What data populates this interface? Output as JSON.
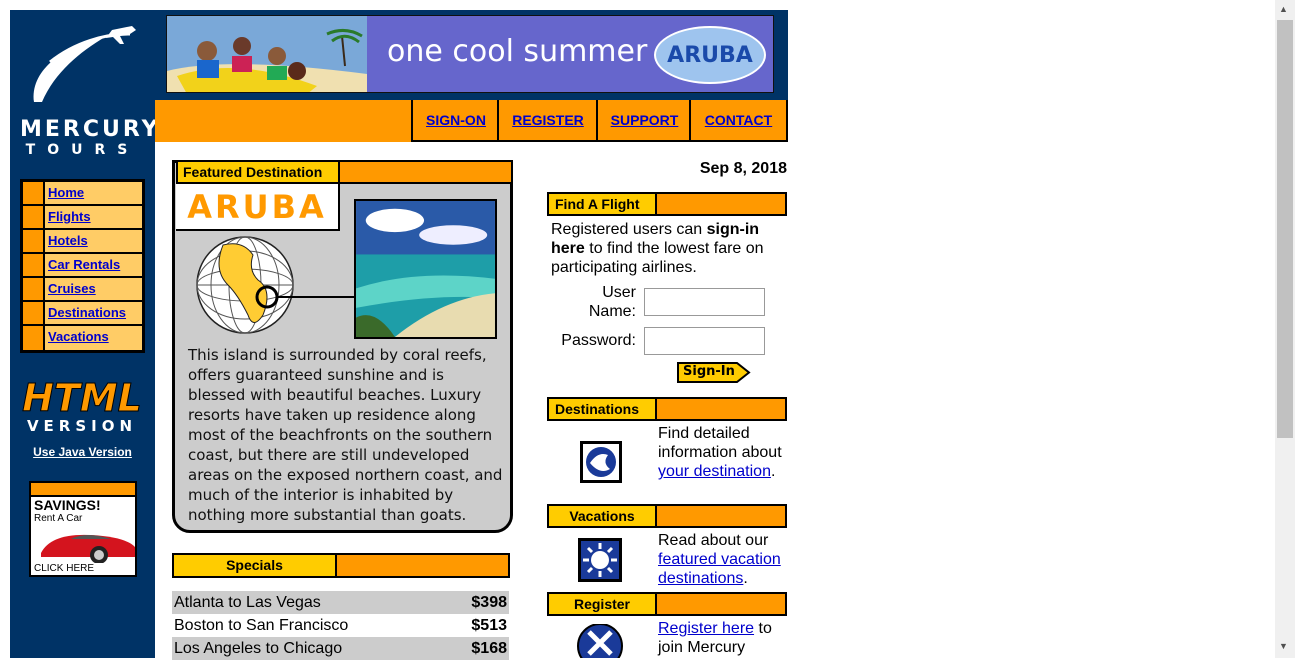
{
  "brand": {
    "name_line1": "MERCURY",
    "name_line2": "TOURS"
  },
  "banner": {
    "text": "one cool summer",
    "logo": "ARUBA"
  },
  "top_nav": [
    "SIGN-ON",
    "REGISTER",
    "SUPPORT",
    "CONTACT"
  ],
  "side_menu": [
    "Home",
    "Flights",
    "Hotels",
    "Car Rentals",
    "Cruises",
    "Destinations",
    "Vacations"
  ],
  "html_version": {
    "line1": "HTML",
    "line2": "VERSION",
    "link": "Use Java Version"
  },
  "savings_ad": {
    "title": "SAVINGS!",
    "sub": "Rent A Car",
    "cta": "CLICK HERE"
  },
  "featured": {
    "header": "Featured Destination",
    "name": "ARUBA",
    "description": "This island is surrounded by coral reefs, offers guaranteed sunshine and is blessed with beautiful beaches. Luxury resorts have taken up residence along most of the beachfronts on the southern coast, but there are still undeveloped areas on the exposed northern coast, and much of the interior is inhabited by nothing more substantial than goats."
  },
  "specials": {
    "header": "Specials",
    "rows": [
      {
        "route": "Atlanta to Las Vegas",
        "price": "$398"
      },
      {
        "route": "Boston to San Francisco",
        "price": "$513"
      },
      {
        "route": "Los Angeles to Chicago",
        "price": "$168"
      }
    ]
  },
  "date": "Sep 8, 2018",
  "find_flight": {
    "header": "Find A Flight",
    "text_pre": "Registered users can ",
    "text_bold": "sign-in here",
    "text_post": " to find the lowest fare on participating airlines.",
    "username_label": "User Name:",
    "password_label": "Password:",
    "signin_button": "Sign-In"
  },
  "destinations": {
    "header": "Destinations",
    "text_pre": "Find detailed information about ",
    "link": "your destination",
    "text_post": "."
  },
  "vacations": {
    "header": "Vacations",
    "text_pre": "Read about our ",
    "link": "featured vacation destinations",
    "text_post": "."
  },
  "register": {
    "header": "Register",
    "link": "Register here",
    "text_post": " to join Mercury"
  },
  "colors": {
    "navy": "#003366",
    "orange": "#ff9900",
    "yellow": "#ffcc00",
    "link": "#0000cc"
  }
}
